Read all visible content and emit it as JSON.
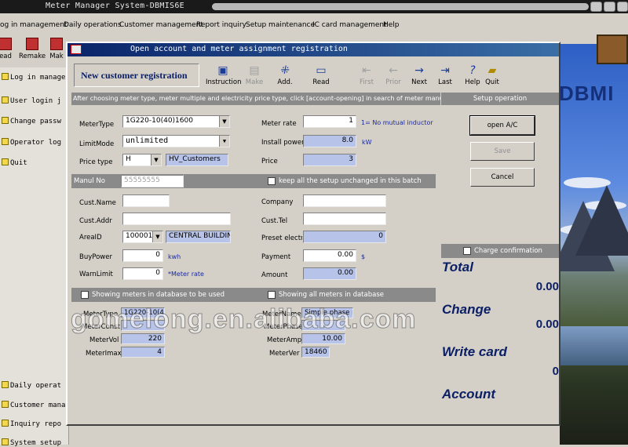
{
  "app": {
    "title": "Meter Manager System-DBMIS6E"
  },
  "menu": [
    "og in management",
    "Daily operations",
    "Customer management",
    "Report inquiry",
    "Setup maintenance",
    "IC card management",
    "Help"
  ],
  "toolbar": [
    "ead",
    "Remake",
    "Mak"
  ],
  "left_panel": {
    "top_items": [
      "Log in manage",
      "User login j",
      "Change passw",
      "Operator log",
      "Quit"
    ],
    "bottom_items": [
      "Daily operat",
      "Customer mana",
      "Inquiry repo",
      "System setup"
    ]
  },
  "background": {
    "logo_text": "DBMI"
  },
  "dialog": {
    "title": "Open account and meter assignment registration",
    "heading": "New customer registration",
    "toolbar": {
      "instruction": "Instruction",
      "make": "Make",
      "add": "Add.",
      "read": "Read",
      "first": "First",
      "prior": "Prior",
      "next": "Next",
      "last": "Last",
      "help": "Help",
      "quit": "Quit"
    },
    "hint": "After choosing meter type, meter multiple and electricity price type, click [account-opening] in search of meter manufactu",
    "setup_operation": "Setup operation",
    "form": {
      "meter_type_label": "MeterType",
      "meter_type_value": "1G220-10(40)1600",
      "limit_mode_label": "LimitMode",
      "limit_mode_value": "unlimited",
      "price_type_label": "Price type",
      "price_type_value": "H",
      "price_type_name": "HV_Customers",
      "meter_rate_label": "Meter rate",
      "meter_rate_value": "1",
      "meter_rate_note": "1= No mutual inductor",
      "install_power_label": "Install power",
      "install_power_value": "8.0",
      "install_power_unit": "kW",
      "price_label": "Price",
      "price_value": "3",
      "manul_no_label": "Manul No",
      "manul_no_value": "55555555",
      "keep_setup_label": "keep all the setup unchanged in this batch",
      "cust_name_label": "Cust.Name",
      "cust_name_value": "",
      "cust_addr_label": "Cust.Addr",
      "cust_addr_value": "",
      "area_id_label": "AreaID",
      "area_id_value": "100001",
      "area_name_value": "CENTRAL BUILDIN",
      "buy_power_label": "BuyPower",
      "buy_power_value": "0",
      "buy_power_unit": "kwh",
      "warn_limit_label": "WarnLimit",
      "warn_limit_value": "0",
      "warn_limit_note": "*Meter rate",
      "company_label": "Company",
      "company_value": "",
      "cust_tel_label": "Cust.Tel",
      "cust_tel_value": "",
      "preset_label": "Preset electric",
      "preset_value": "0",
      "payment_label": "Payment",
      "payment_value": "0.00",
      "payment_unit": "$",
      "amount_label": "Amount",
      "amount_value": "0.00"
    },
    "meters_section": {
      "used_label": "Showing meters in database to be used",
      "all_label": "Showing all meters in database",
      "meter_type_label": "MeterType",
      "meter_type_value": "1G220-10(40)16",
      "meter_const_label": "MeterConst",
      "meter_const_value": "",
      "meter_vol_label": "MeterVol",
      "meter_vol_value": "220",
      "meter_imax_label": "MeterImax",
      "meter_imax_value": "4",
      "meter_name_label": "MeterName",
      "meter_name_value": "Simple phase meter",
      "meter_phase_label": "MeterPhase",
      "meter_phase_value": "",
      "meter_amp_label": "MeterAmp",
      "meter_amp_value": "10.00",
      "meter_ver_label": "MeterVer",
      "meter_ver_value": "18460"
    },
    "buttons": {
      "open": "open A/C",
      "save": "Save",
      "cancel": "Cancel"
    },
    "charge_confirmation": "Charge confirmation",
    "summary": {
      "total_label": "Total",
      "total_value": "0.00",
      "change_label": "Change",
      "change_value": "0.00",
      "write_card_label": "Write card",
      "write_card_value": "0",
      "account_label": "Account"
    }
  },
  "watermark": "gomelong.en.alibaba.com"
}
